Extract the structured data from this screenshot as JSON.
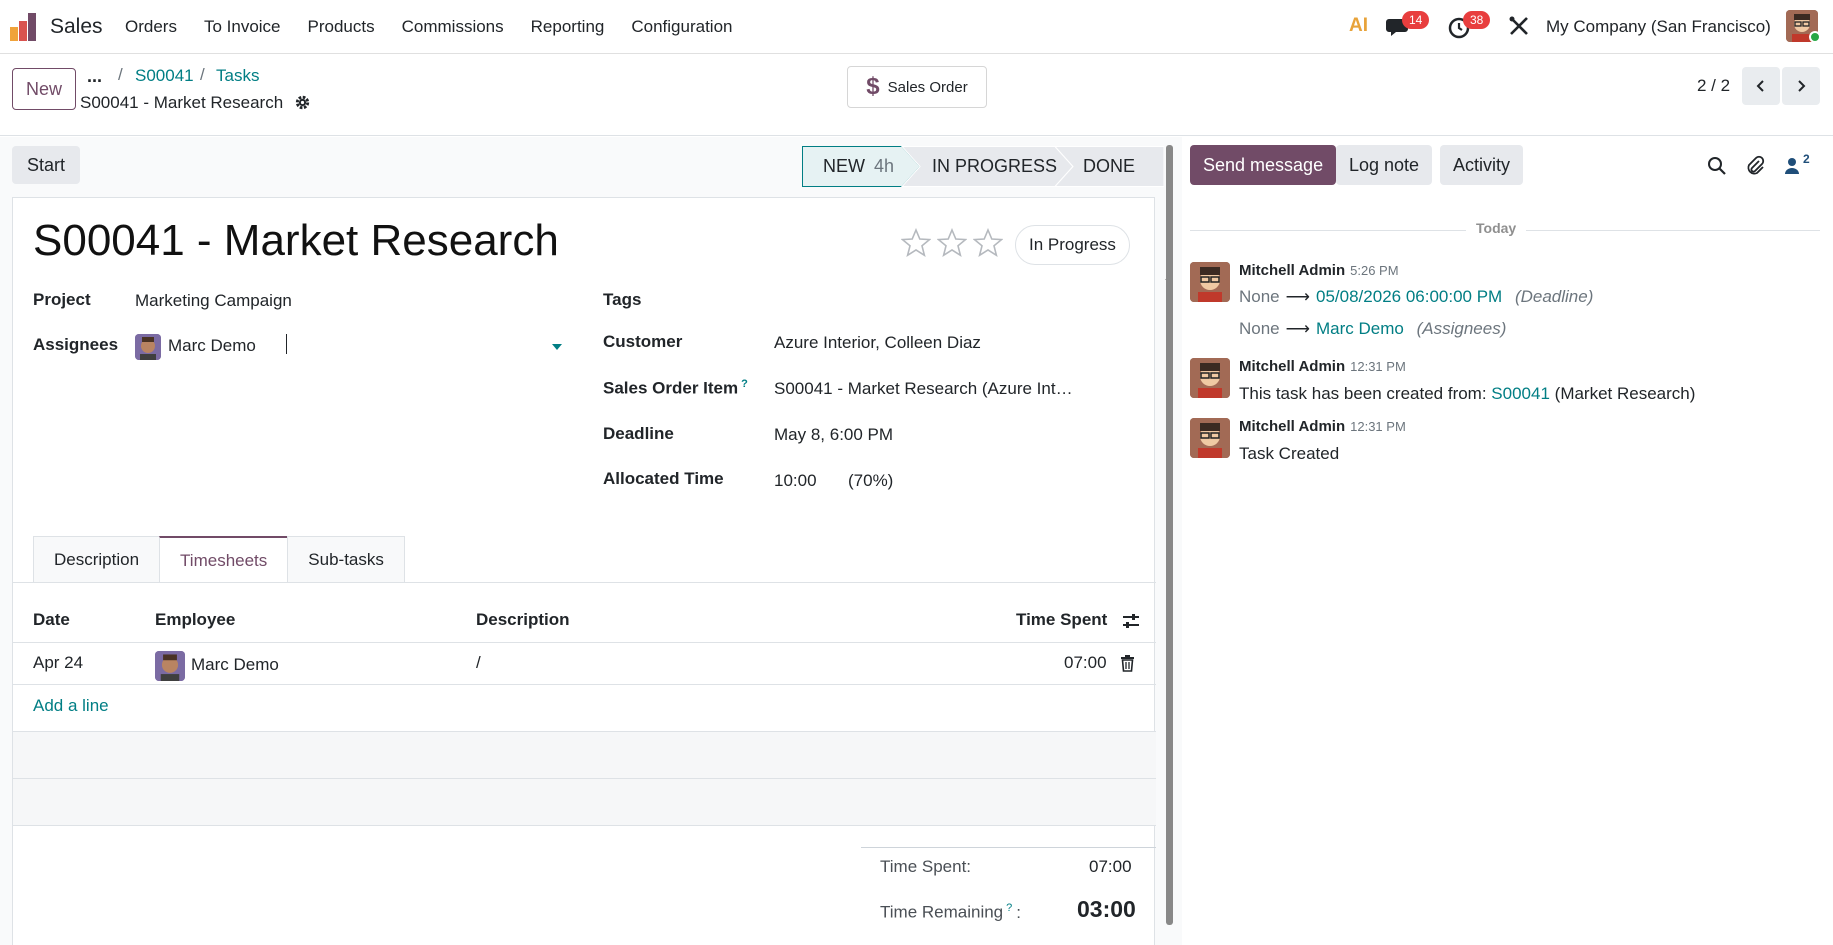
{
  "navbar": {
    "app_name": "Sales",
    "menu": [
      "Orders",
      "To Invoice",
      "Products",
      "Commissions",
      "Reporting",
      "Configuration"
    ],
    "ai_label": "AI",
    "messages_count": "14",
    "activities_count": "38",
    "company": "My Company (San Francisco)"
  },
  "control": {
    "new_label": "New",
    "breadcrumb_dots": "...",
    "breadcrumb": [
      "S00041",
      "Tasks"
    ],
    "current": "S00041 - Market Research",
    "sales_order_label": "Sales Order",
    "pager": "2 / 2"
  },
  "status": {
    "start_label": "Start",
    "stages": [
      {
        "label": "NEW",
        "extra": "4h"
      },
      {
        "label": "IN PROGRESS",
        "extra": ""
      },
      {
        "label": "DONE",
        "extra": ""
      }
    ]
  },
  "form": {
    "title": "S00041 - Market Research",
    "state_badge": "In Progress",
    "project_label": "Project",
    "project_value": "Marketing Campaign",
    "assignees_label": "Assignees",
    "assignee_value": "Marc Demo",
    "tags_label": "Tags",
    "customer_label": "Customer",
    "customer_value": "Azure Interior, Colleen Diaz",
    "soi_label": "Sales Order Item",
    "soi_help": "?",
    "soi_value": "S00041 - Market Research (Azure Int…",
    "deadline_label": "Deadline",
    "deadline_value": "May 8, 6:00 PM",
    "allocated_label": "Allocated Time",
    "allocated_value": "10:00",
    "allocated_percent": "(70%)"
  },
  "tabs": [
    "Description",
    "Timesheets",
    "Sub-tasks"
  ],
  "timesheet": {
    "columns": [
      "Date",
      "Employee",
      "Description",
      "Time Spent"
    ],
    "rows": [
      {
        "date": "Apr 24",
        "employee": "Marc Demo",
        "description": "/",
        "time": "07:00"
      }
    ],
    "add_line": "Add a line",
    "time_spent_label": "Time Spent:",
    "time_spent_value": "07:00",
    "time_remaining_label": "Time Remaining",
    "time_remaining_help": "?",
    "time_remaining_colon": ":",
    "time_remaining_value": "03:00"
  },
  "chatter": {
    "send_label": "Send message",
    "log_label": "Log note",
    "activity_label": "Activity",
    "followers_count": "2",
    "today_label": "Today",
    "messages": [
      {
        "author": "Mitchell Admin",
        "time": "5:26 PM",
        "line1_old": "None",
        "line1_new": "05/08/2026 06:00:00 PM",
        "line1_field": "(Deadline)",
        "line2_old": "None",
        "line2_new": "Marc Demo",
        "line2_field": "(Assignees)"
      },
      {
        "author": "Mitchell Admin",
        "time": "12:31 PM",
        "text_prefix": "This task has been created from:",
        "link": "S00041",
        "text_suffix": "(Market Research)"
      },
      {
        "author": "Mitchell Admin",
        "time": "12:31 PM",
        "text": "Task Created"
      }
    ]
  }
}
